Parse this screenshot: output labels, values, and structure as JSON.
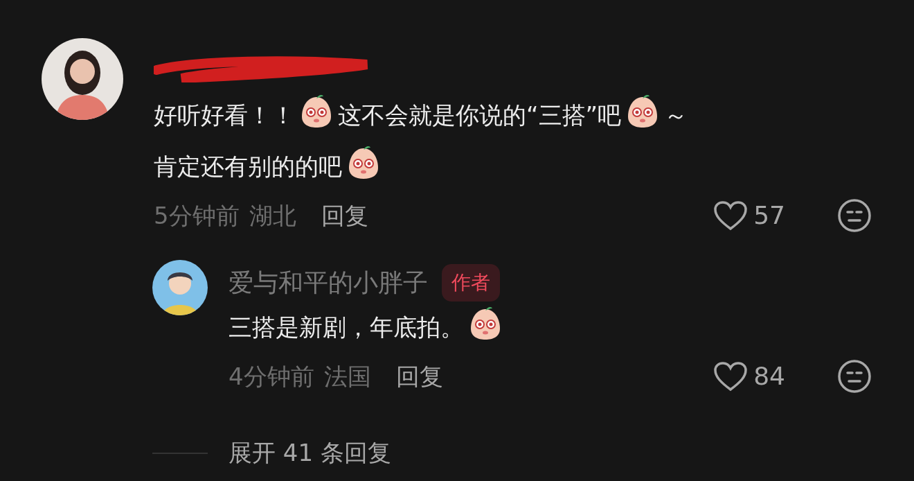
{
  "comments": [
    {
      "author_redacted": true,
      "content": [
        {
          "kind": "text",
          "text": "好听好看！！"
        },
        {
          "kind": "sticker"
        },
        {
          "kind": "text",
          "text": "这不会就是你说的“三搭”吧"
        },
        {
          "kind": "sticker"
        },
        {
          "kind": "text",
          "text": "～"
        },
        {
          "kind": "line_break"
        },
        {
          "kind": "text",
          "text": "肯定还有别的的吧"
        },
        {
          "kind": "sticker"
        }
      ],
      "time": "5分钟前",
      "location": "湖北",
      "reply_label": "回复",
      "likes": "57",
      "liked": false,
      "replies": [
        {
          "author": "爱与和平的小胖子",
          "badge": "作者",
          "content": [
            {
              "kind": "text",
              "text": "三搭是新剧，年底拍。"
            },
            {
              "kind": "sticker"
            }
          ],
          "time": "4分钟前",
          "location": "法国",
          "reply_label": "回复",
          "likes": "84",
          "liked": false
        }
      ],
      "expand_label": "展开 41 条回复"
    }
  ]
}
